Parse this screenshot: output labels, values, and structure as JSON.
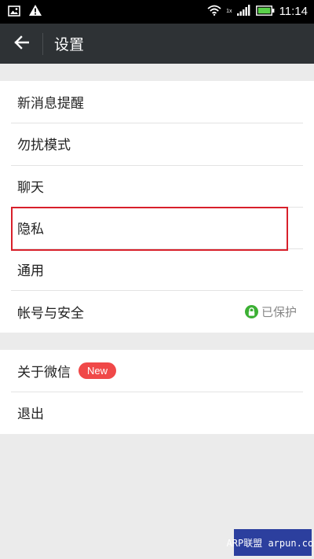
{
  "status_bar": {
    "time": "11:14",
    "left_icons": [
      "image-icon",
      "warning-icon"
    ],
    "right_icons": [
      "wifi-icon",
      "signal-icon",
      "battery-icon"
    ],
    "network_label": "1x"
  },
  "header": {
    "back_icon": "arrow-left-icon",
    "title": "设置"
  },
  "settings": {
    "group1": [
      {
        "label": "新消息提醒"
      },
      {
        "label": "勿扰模式"
      },
      {
        "label": "聊天"
      },
      {
        "label": "隐私"
      },
      {
        "label": "通用"
      },
      {
        "label": "帐号与安全",
        "status": "已保护",
        "status_icon": "lock-icon"
      }
    ],
    "group2": [
      {
        "label": "关于微信",
        "badge": "New"
      },
      {
        "label": "退出"
      }
    ]
  },
  "watermark": "ARP联盟 arpun.com",
  "colors": {
    "header_bg": "#2e3235",
    "page_bg": "#ebebeb",
    "badge_red": "#f04848",
    "lock_green": "#3cb034",
    "highlight_red": "#d8202b"
  }
}
